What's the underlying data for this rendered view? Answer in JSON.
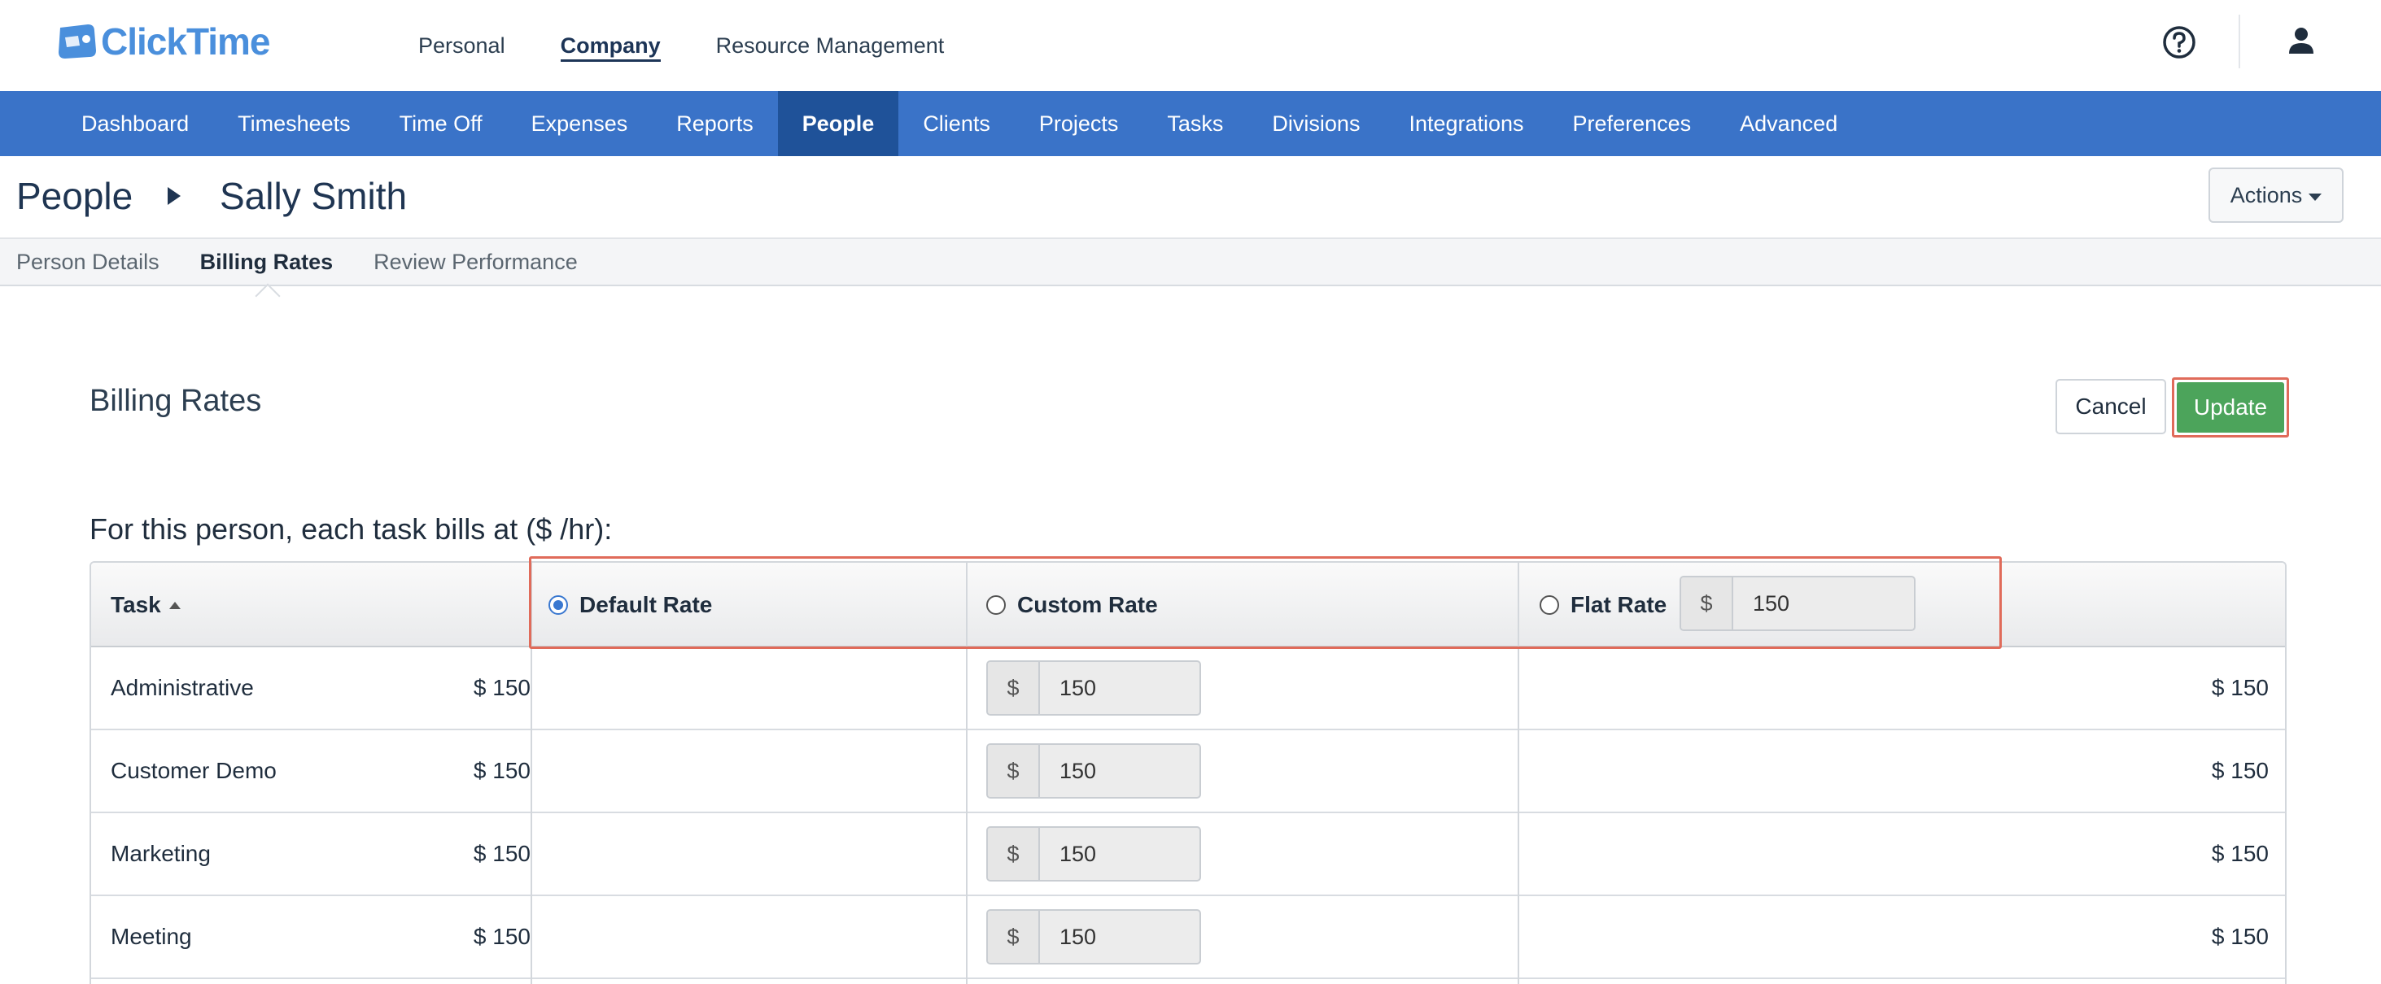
{
  "app": {
    "logo_text": "ClickTime"
  },
  "top_nav": [
    {
      "label": "Personal",
      "active": false
    },
    {
      "label": "Company",
      "active": true
    },
    {
      "label": "Resource Management",
      "active": false
    }
  ],
  "main_nav": [
    {
      "label": "Dashboard",
      "active": false
    },
    {
      "label": "Timesheets",
      "active": false
    },
    {
      "label": "Time Off",
      "active": false
    },
    {
      "label": "Expenses",
      "active": false
    },
    {
      "label": "Reports",
      "active": false
    },
    {
      "label": "People",
      "active": true
    },
    {
      "label": "Clients",
      "active": false
    },
    {
      "label": "Projects",
      "active": false
    },
    {
      "label": "Tasks",
      "active": false
    },
    {
      "label": "Divisions",
      "active": false
    },
    {
      "label": "Integrations",
      "active": false
    },
    {
      "label": "Preferences",
      "active": false
    },
    {
      "label": "Advanced",
      "active": false
    }
  ],
  "breadcrumb": {
    "section": "People",
    "person": "Sally Smith"
  },
  "actions_label": "Actions",
  "sub_tabs": [
    {
      "label": "Person Details",
      "active": false
    },
    {
      "label": "Billing Rates",
      "active": true
    },
    {
      "label": "Review Performance",
      "active": false
    }
  ],
  "billing": {
    "title": "Billing Rates",
    "cancel_label": "Cancel",
    "update_label": "Update",
    "intro": "For this person, each task bills at ($ /hr):",
    "header": {
      "task": "Task",
      "default_rate": "Default Rate",
      "custom_rate": "Custom Rate",
      "flat_rate": "Flat Rate",
      "flat_prefix": "$",
      "flat_value": "150",
      "selected": "default_rate"
    },
    "rows": [
      {
        "task": "Administrative",
        "default": "$ 150",
        "custom_prefix": "$",
        "custom_value": "150",
        "flat": "$ 150"
      },
      {
        "task": "Customer Demo",
        "default": "$ 150",
        "custom_prefix": "$",
        "custom_value": "150",
        "flat": "$ 150"
      },
      {
        "task": "Marketing",
        "default": "$ 150",
        "custom_prefix": "$",
        "custom_value": "150",
        "flat": "$ 150"
      },
      {
        "task": "Meeting",
        "default": "$ 150",
        "custom_prefix": "$",
        "custom_value": "150",
        "flat": "$ 150"
      }
    ]
  },
  "colors": {
    "nav_blue": "#3a73c8",
    "nav_active": "#1f5299",
    "update_green": "#4ca45b",
    "highlight": "#e06b5a",
    "logo_blue": "#4a8fdc"
  },
  "icons": {
    "help": "help-circle-icon",
    "user": "user-icon",
    "logo": "clicktime-logo-icon"
  }
}
